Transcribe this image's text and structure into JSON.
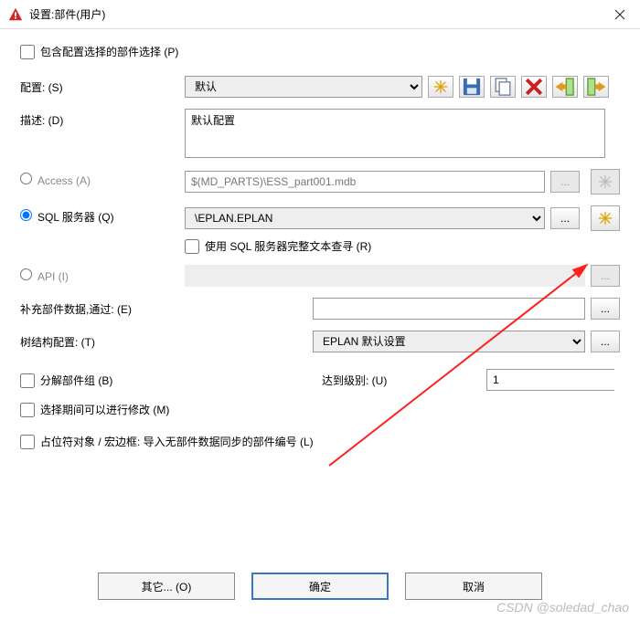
{
  "window": {
    "title": "设置:部件(用户)"
  },
  "topcheck": {
    "label": "包含配置选择的部件选择 (P)"
  },
  "config": {
    "label": "配置: (S)",
    "selected": "默认"
  },
  "desc": {
    "label": "描述: (D)",
    "value": "默认配置"
  },
  "access": {
    "label": "Access (A)",
    "path": "$(MD_PARTS)\\ESS_part001.mdb"
  },
  "sql": {
    "label": "SQL 服务器 (Q)",
    "selected": "\\EPLAN.EPLAN",
    "full_text_label": "使用 SQL 服务器完整文本查寻 (R)"
  },
  "api": {
    "label": "API (I)"
  },
  "supp": {
    "label": "补充部件数据,通过: (E)"
  },
  "tree": {
    "label": "树结构配置: (T)",
    "selected": "EPLAN 默认设置"
  },
  "decompose": {
    "label": "分解部件组 (B)"
  },
  "level": {
    "label": "达到级别: (U)",
    "value": "1"
  },
  "modify_during": {
    "label": "选择期间可以进行修改 (M)"
  },
  "placeholder": {
    "label": "占位符对象 / 宏边框: 导入无部件数据同步的部件编号 (L)"
  },
  "buttons": {
    "other": "其它... (O)",
    "ok": "确定",
    "cancel": "取消"
  },
  "toolbar": {
    "dots": "..."
  },
  "watermark": "CSDN @soledad_chao"
}
